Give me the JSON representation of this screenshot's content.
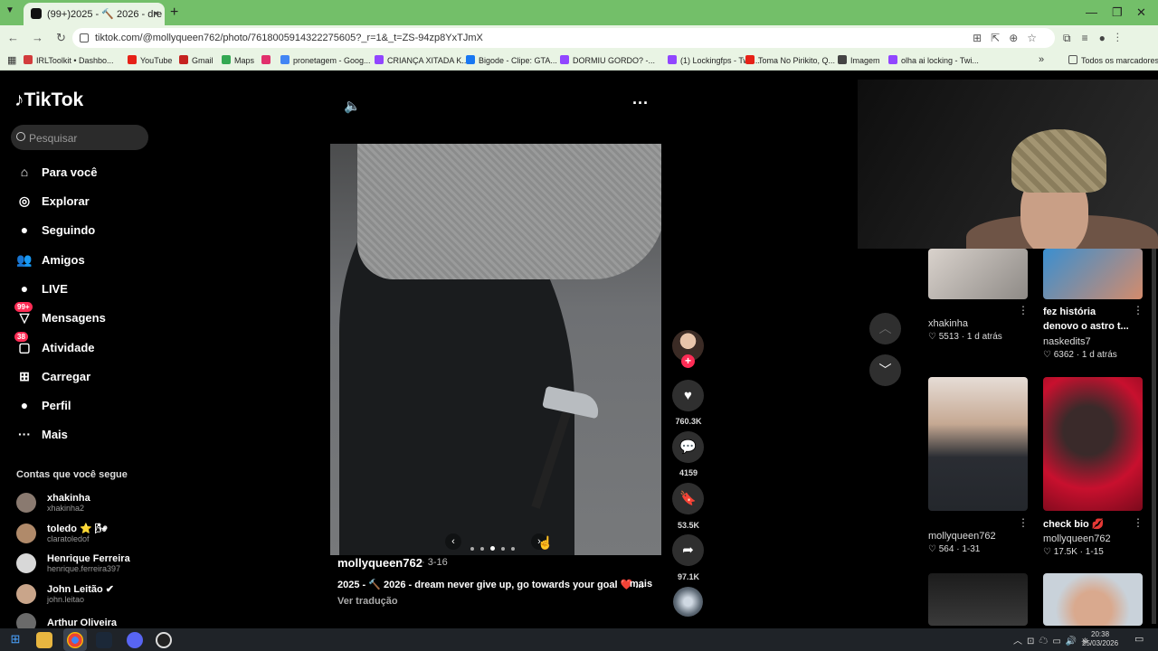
{
  "browser": {
    "tab_title": "(99+)2025 - 🔨 2026 - dre",
    "tab_close": "×",
    "new_tab": "+",
    "url": "tiktok.com/@mollyqueen762/photo/7618005914322275605?_r=1&_t=ZS-94zp8YxTJmX",
    "bookmarks": [
      {
        "label": "IRLToolkit • Dashbo...",
        "color": "#d23c3c"
      },
      {
        "label": "YouTube",
        "color": "#e62117"
      },
      {
        "label": "Gmail",
        "color": "#c5221f"
      },
      {
        "label": "Maps",
        "color": "#34a853"
      },
      {
        "label": "",
        "color": "#e1306c"
      },
      {
        "label": "pronetagem - Goog...",
        "color": "#4285f4"
      },
      {
        "label": "CRIANÇA XITADA K...",
        "color": "#9146ff"
      },
      {
        "label": "Bigode - Clipe: GTA...",
        "color": "#1877f2"
      },
      {
        "label": "DORMIU GORDO? -...",
        "color": "#9146ff"
      },
      {
        "label": "(1) Lockingfps - Twit...",
        "color": "#9146ff"
      },
      {
        "label": "Toma No Pirikito, Q...",
        "color": "#e62117"
      },
      {
        "label": "Imagem",
        "color": "#444"
      },
      {
        "label": "olha ai locking - Twi...",
        "color": "#9146ff"
      }
    ],
    "all_bookmarks": "Todos os marcadores"
  },
  "sidebar": {
    "logo": "TikTok",
    "search_placeholder": "Pesquisar",
    "nav": [
      {
        "label": "Para você",
        "icon": "⌂"
      },
      {
        "label": "Explorar",
        "icon": "◎"
      },
      {
        "label": "Seguindo",
        "icon": "●"
      },
      {
        "label": "Amigos",
        "icon": "👥"
      },
      {
        "label": "LIVE",
        "icon": "●"
      },
      {
        "label": "Mensagens",
        "icon": "▽",
        "badge": "99+"
      },
      {
        "label": "Atividade",
        "icon": "▢",
        "badge": "38"
      },
      {
        "label": "Carregar",
        "icon": "⊞"
      },
      {
        "label": "Perfil",
        "icon": "●"
      },
      {
        "label": "Mais",
        "icon": "···"
      }
    ],
    "following_header": "Contas que você segue",
    "accounts": [
      {
        "name": "xhakinha",
        "user": "xhakinha2"
      },
      {
        "name": "toledo ⭐ 🌬",
        "user": "claratoledof"
      },
      {
        "name": "Henrique Ferreira",
        "user": "henrique.ferreira397"
      },
      {
        "name": "John Leitão ✔",
        "user": "john.leitao"
      },
      {
        "name": "Arthur Oliveira",
        "user": ""
      }
    ]
  },
  "post": {
    "author": "mollyqueen762",
    "date": "· 3-16",
    "caption": "2025 - 🔨 2026 - dream never give up, go towards your goal ❤️ ...",
    "more": "mais",
    "translate": "Ver tradução",
    "likes": "760.3K",
    "comments": "4159",
    "saves": "53.5K",
    "shares": "97.1K"
  },
  "grid": [
    {
      "title": "xhakinha",
      "likes": "♡ 5513",
      "time": "· 1 d atrás",
      "bold": false
    },
    {
      "title": "fez história denovo o astro t...",
      "user": "naskedits7",
      "likes": "♡ 6362",
      "time": "· 1 d atrás",
      "bold": true
    },
    {
      "user": "mollyqueen762",
      "likes": "♡ 564",
      "time": "· 1-31"
    },
    {
      "title": "check bio 💋",
      "user": "mollyqueen762",
      "likes": "♡ 17.5K",
      "time": "· 1-15"
    }
  ],
  "taskbar": {
    "time": "20:38",
    "date": "25/03/2026"
  },
  "colors": {
    "accent": "#fe2c55",
    "chrome": "#73bf69"
  }
}
